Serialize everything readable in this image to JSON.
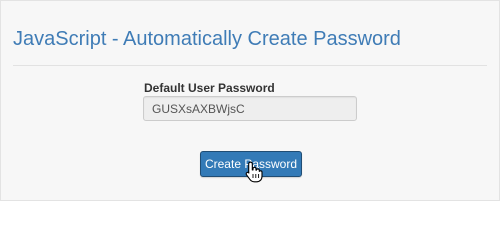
{
  "page": {
    "title": "JavaScript - Automatically Create Password"
  },
  "form": {
    "password_label": "Default User Password",
    "password_value": "GUSXsAXBWjsC",
    "create_button_label": "Create Password"
  },
  "icons": {
    "cursor": "hand-pointer-icon"
  },
  "colors": {
    "title": "#3f7cb6",
    "button": "#337ab7",
    "input_background": "#eeeeee",
    "page_background": "#f7f7f7"
  }
}
